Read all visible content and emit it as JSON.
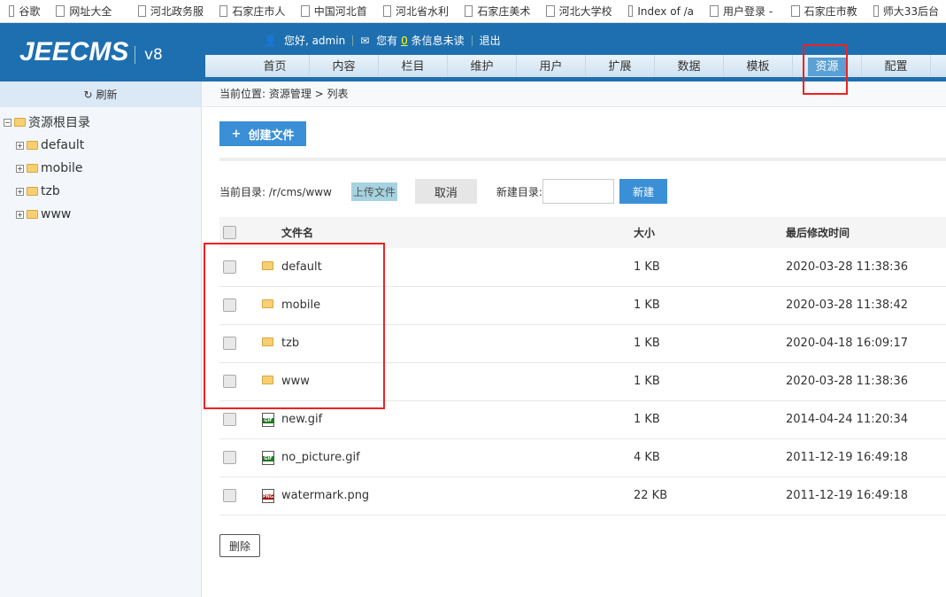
{
  "bookmarks": [
    "谷歌",
    "网址大全",
    "河北政务服",
    "石家庄市人",
    "中国河北首",
    "河北省水利",
    "石家庄美术",
    "河北大学校",
    "Index of /a",
    "用户登录 -",
    "石家庄市教",
    "师大33后台"
  ],
  "header": {
    "logo": "JEECMS",
    "version": "v8",
    "greeting": "您好, admin",
    "msg_prefix": "您有",
    "msg_count": "0",
    "msg_suffix": "条信息未读",
    "logout": "退出"
  },
  "nav": [
    "首页",
    "内容",
    "栏目",
    "维护",
    "用户",
    "扩展",
    "数据",
    "模板",
    "资源",
    "配置"
  ],
  "nav_active": "资源",
  "sidebar": {
    "refresh": "刷新",
    "root": "资源根目录",
    "folders": [
      "default",
      "mobile",
      "tzb",
      "www"
    ]
  },
  "breadcrumb": "当前位置: 资源管理 > 列表",
  "create_label": "创建文件",
  "toolbar": {
    "current_dir_label": "当前目录: /r/cms/www",
    "upload": "上传文件",
    "cancel": "取消",
    "new_dir_label": "新建目录:",
    "new_dir_value": "",
    "new_button": "新建"
  },
  "table": {
    "headers": [
      "文件名",
      "大小",
      "最后修改时间"
    ],
    "rows": [
      {
        "type": "folder",
        "name": "default",
        "size": "1 KB",
        "time": "2020-03-28 11:38:36"
      },
      {
        "type": "folder",
        "name": "mobile",
        "size": "1 KB",
        "time": "2020-03-28 11:38:42"
      },
      {
        "type": "folder",
        "name": "tzb",
        "size": "1 KB",
        "time": "2020-04-18 16:09:17"
      },
      {
        "type": "folder",
        "name": "www",
        "size": "1 KB",
        "time": "2020-03-28 11:38:36"
      },
      {
        "type": "gif",
        "name": "new.gif",
        "size": "1 KB",
        "time": "2014-04-24 11:20:34"
      },
      {
        "type": "gif",
        "name": "no_picture.gif",
        "size": "4 KB",
        "time": "2011-12-19 16:49:18"
      },
      {
        "type": "png",
        "name": "watermark.png",
        "size": "22 KB",
        "time": "2011-12-19 16:49:18"
      }
    ]
  },
  "delete_label": "删除"
}
